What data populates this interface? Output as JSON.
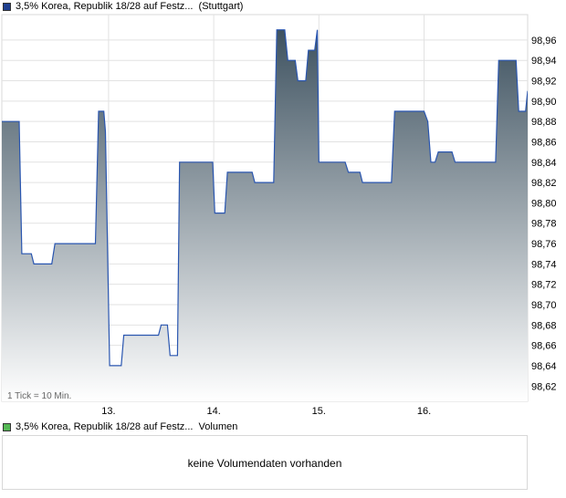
{
  "legend": {
    "price_label": "3,5% Korea, Republik 18/28 auf Festz...  (Stuttgart)",
    "price_color": "#1f3f8f",
    "volume_label": "3,5% Korea, Republik 18/28 auf Festz...  Volumen",
    "volume_color": "#55b855"
  },
  "chart_note": "1 Tick = 10 Min.",
  "volume_panel": {
    "message": "keine Volumendaten vorhanden"
  },
  "chart_data": {
    "type": "area",
    "line_color": "#2a56b0",
    "fill_top_color": "#3e5260",
    "fill_bottom_color": "#ffffff",
    "grid": true,
    "y_axis_side": "right",
    "ylim": [
      98.605,
      98.985
    ],
    "xlim": [
      0,
      100
    ],
    "x_ticks": [
      {
        "label": "13.",
        "x": 20.3
      },
      {
        "label": "14.",
        "x": 40.3
      },
      {
        "label": "15.",
        "x": 60.3
      },
      {
        "label": "16.",
        "x": 80.3
      }
    ],
    "y_ticks": [
      "98,62",
      "98,64",
      "98,66",
      "98,68",
      "98,70",
      "98,72",
      "98,74",
      "98,76",
      "98,78",
      "98,80",
      "98,82",
      "98,84",
      "98,86",
      "98,88",
      "98,90",
      "98,92",
      "98,94",
      "98,96"
    ],
    "y_tick_values": [
      98.62,
      98.64,
      98.66,
      98.68,
      98.7,
      98.72,
      98.74,
      98.76,
      98.78,
      98.8,
      98.82,
      98.84,
      98.86,
      98.88,
      98.9,
      98.92,
      98.94,
      98.96
    ],
    "points": [
      [
        0,
        98.88
      ],
      [
        3.3,
        98.88
      ],
      [
        3.8,
        98.75
      ],
      [
        5.6,
        98.75
      ],
      [
        6.1,
        98.74
      ],
      [
        9.5,
        98.74
      ],
      [
        10.1,
        98.76
      ],
      [
        17.8,
        98.76
      ],
      [
        18.4,
        98.89
      ],
      [
        19.4,
        98.89
      ],
      [
        19.7,
        98.87
      ],
      [
        20.5,
        98.64
      ],
      [
        22.7,
        98.64
      ],
      [
        23.2,
        98.67
      ],
      [
        29.8,
        98.67
      ],
      [
        30.3,
        98.68
      ],
      [
        31.5,
        98.68
      ],
      [
        32.0,
        98.65
      ],
      [
        33.4,
        98.65
      ],
      [
        33.8,
        98.84
      ],
      [
        40.1,
        98.84
      ],
      [
        40.5,
        98.79
      ],
      [
        42.4,
        98.79
      ],
      [
        42.9,
        98.83
      ],
      [
        47.6,
        98.83
      ],
      [
        48.1,
        98.82
      ],
      [
        51.7,
        98.82
      ],
      [
        52.3,
        98.97
      ],
      [
        53.8,
        98.97
      ],
      [
        54.4,
        98.94
      ],
      [
        55.8,
        98.94
      ],
      [
        56.3,
        98.92
      ],
      [
        57.8,
        98.92
      ],
      [
        58.3,
        98.95
      ],
      [
        59.5,
        98.95
      ],
      [
        60.0,
        98.97
      ],
      [
        60.3,
        98.84
      ],
      [
        65.3,
        98.84
      ],
      [
        65.9,
        98.83
      ],
      [
        68.1,
        98.83
      ],
      [
        68.6,
        98.82
      ],
      [
        74.1,
        98.82
      ],
      [
        74.7,
        98.89
      ],
      [
        80.3,
        98.89
      ],
      [
        81.0,
        98.88
      ],
      [
        81.6,
        98.84
      ],
      [
        82.4,
        98.84
      ],
      [
        83.0,
        98.85
      ],
      [
        85.6,
        98.85
      ],
      [
        86.2,
        98.84
      ],
      [
        93.9,
        98.84
      ],
      [
        94.5,
        98.94
      ],
      [
        97.8,
        98.94
      ],
      [
        98.3,
        98.89
      ],
      [
        99.6,
        98.89
      ],
      [
        100,
        98.91
      ]
    ]
  }
}
